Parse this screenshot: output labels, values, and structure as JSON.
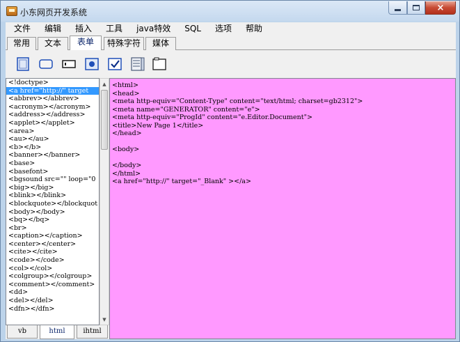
{
  "window": {
    "title": "小东网页开发系统",
    "controls": {
      "minimize": "minimize",
      "maximize": "maximize",
      "close": "×"
    }
  },
  "menu": [
    "文件",
    "编辑",
    "插入",
    "工具",
    "java特效",
    "SQL",
    "选项",
    "帮助"
  ],
  "tabs": [
    {
      "label": "常用",
      "active": false
    },
    {
      "label": "文本",
      "active": false
    },
    {
      "label": "表单",
      "active": true
    },
    {
      "label": "特殊字符",
      "active": false
    },
    {
      "label": "媒体",
      "active": false
    }
  ],
  "toolbar": {
    "icons": [
      "form-icon",
      "button-icon",
      "textbox-icon",
      "radio-icon",
      "checkbox-icon",
      "list-icon",
      "frame-icon"
    ],
    "accent": "#1f4fb8"
  },
  "tag_list": {
    "selected_index": 1,
    "items": [
      "<!doctype>",
      "<a href=\"http://\" target",
      "<abbrev></abbrev>",
      "<acronym></acronym>",
      "<address></address>",
      "<applet></applet>",
      "<area>",
      "<au></au>",
      "<b></b>",
      "<banner></banner>",
      "<base>",
      "<basefont>",
      "<bgsound src=\"\" loop=\"0",
      "<big></big>",
      "<blink></blink>",
      "<blockquote></blockquot",
      "<body></body>",
      "<bq></bq>",
      "<br>",
      "<caption></caption>",
      "<center></center>",
      "<cite></cite>",
      "<code></code>",
      "<col></col>",
      "<colgroup></colgroup>",
      "<comment></comment>",
      "<dd>",
      "<del></del>",
      "<dfn></dfn>"
    ]
  },
  "bottom_tabs": [
    {
      "label": "vb",
      "active": false
    },
    {
      "label": "html",
      "active": true
    },
    {
      "label": "ihtml",
      "active": false
    }
  ],
  "editor": {
    "background": "#ff99ff",
    "lines": [
      "<html>",
      "<head>",
      "<meta http-equiv=\"Content-Type\" content=\"text/html; charset=gb2312\">",
      "<meta name=\"GENERATOR\" content=\"e\">",
      "<meta http-equiv=\"ProgId\" content=\"e.Editor.Document\">",
      "<title>New Page 1</title>",
      "</head>",
      "",
      "<body>",
      "",
      "</body>",
      "</html>",
      "<a href=\"http://\" target=\"_Blank\" ></a>"
    ]
  }
}
